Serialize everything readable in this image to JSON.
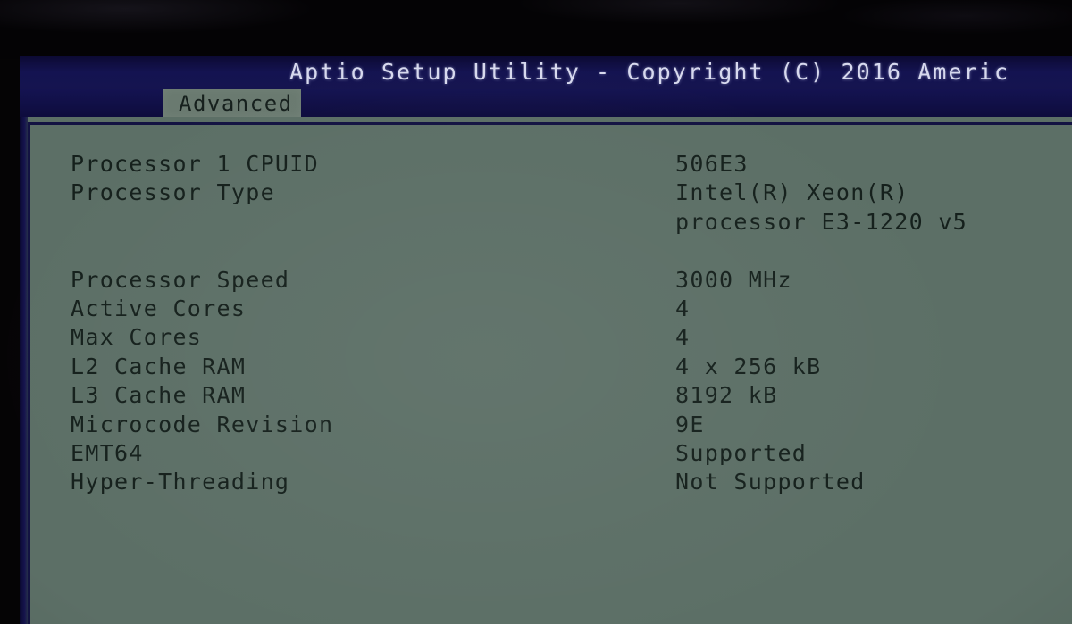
{
  "window": {
    "title": "Aptio Setup Utility - Copyright (C) 2016 Americ",
    "title_full_hint": "Aptio Setup Utility - Copyright (C) 2016 Americ",
    "colors": {
      "titlebar_blue": "#141351",
      "content_sage": "#5c6f66",
      "text_dark": "#15201c",
      "title_text": "#d7d9ee",
      "bezel_black": "#050405",
      "frame_navy": "#131342"
    }
  },
  "tabs": [
    {
      "label": "Advanced",
      "selected": true
    }
  ],
  "main": {
    "rows": [
      {
        "label": "Processor 1 CPUID",
        "value": "506E3",
        "continuation": false,
        "gap_after": false
      },
      {
        "label": "Processor Type",
        "value": "Intel(R) Xeon(R)",
        "continuation": false,
        "gap_after": false
      },
      {
        "label": "",
        "value": "processor E3-1220 v5",
        "continuation": true,
        "gap_after": false
      },
      {
        "label": "Processor Speed",
        "value": "3000 MHz",
        "continuation": false,
        "gap_after": false
      },
      {
        "label": "Active Cores",
        "value": "4",
        "continuation": false,
        "gap_after": false
      },
      {
        "label": "Max Cores",
        "value": "4",
        "continuation": false,
        "gap_after": false
      },
      {
        "label": "L2 Cache RAM",
        "value": "4 x 256 kB",
        "continuation": false,
        "gap_after": false
      },
      {
        "label": "L3 Cache RAM",
        "value": "8192 kB",
        "continuation": false,
        "gap_after": false
      },
      {
        "label": "Microcode Revision",
        "value": "9E",
        "continuation": false,
        "gap_after": false
      },
      {
        "label": "EMT64",
        "value": "Supported",
        "continuation": false,
        "gap_after": false
      },
      {
        "label": "Hyper-Threading",
        "value": "Not Supported",
        "continuation": false,
        "gap_after": false
      }
    ]
  }
}
